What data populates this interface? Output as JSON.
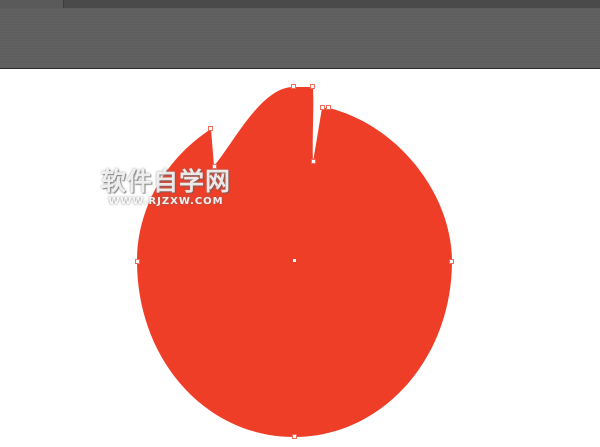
{
  "app": {
    "accent_shape_color": "#ef3e28",
    "anchor_point_color": "#ef6d5a",
    "toolbar_color": "#5f5f5f"
  },
  "watermark": {
    "title": "软件自学网",
    "url": "WWW.RJZXW.COM"
  }
}
